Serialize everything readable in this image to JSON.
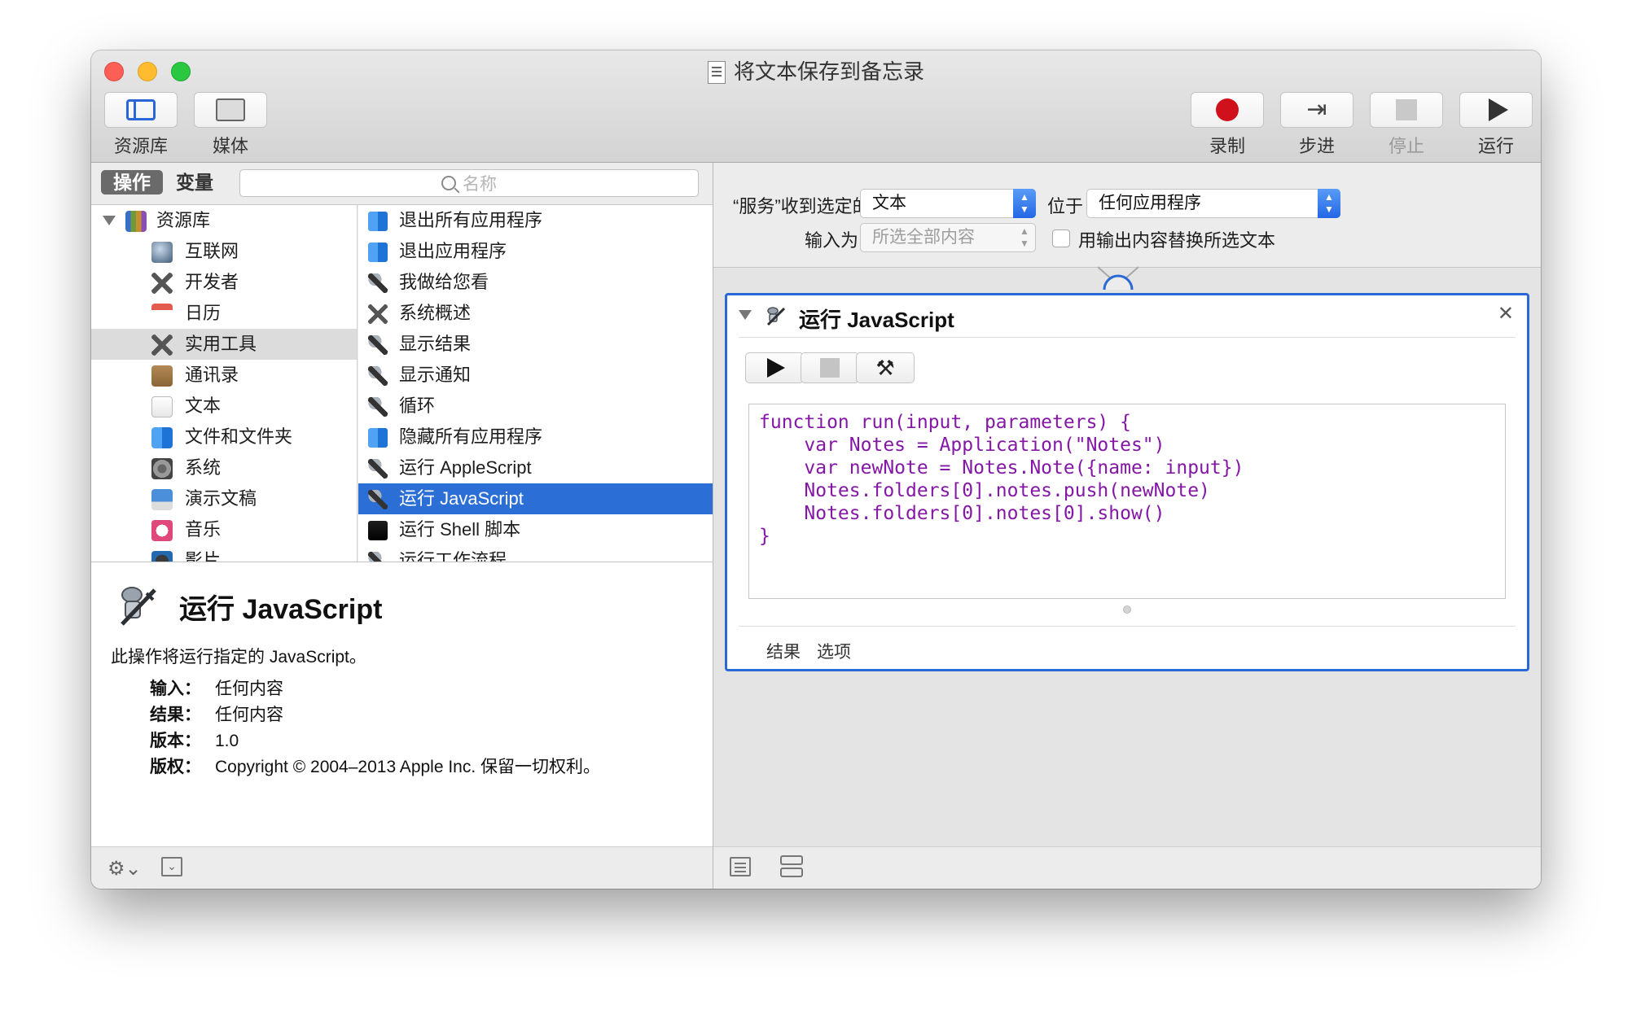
{
  "window": {
    "title": "将文本保存到备忘录"
  },
  "toolbar": {
    "left": [
      {
        "label": "资源库",
        "icon": "library-icon"
      },
      {
        "label": "媒体",
        "icon": "media-icon"
      }
    ],
    "right": [
      {
        "label": "录制",
        "icon": "record-icon",
        "enabled": true
      },
      {
        "label": "步进",
        "icon": "step-icon",
        "enabled": true
      },
      {
        "label": "停止",
        "icon": "stop-icon",
        "enabled": false
      },
      {
        "label": "运行",
        "icon": "run-icon",
        "enabled": true
      }
    ]
  },
  "library": {
    "segments": {
      "actions": "操作",
      "variables": "变量"
    },
    "search_placeholder": "名称",
    "categories": [
      {
        "label": "资源库",
        "icon": "library-books-icon",
        "root": true,
        "selected": false
      },
      {
        "label": "互联网",
        "icon": "globe-icon",
        "selected": false
      },
      {
        "label": "开发者",
        "icon": "tools-icon",
        "selected": false
      },
      {
        "label": "日历",
        "icon": "calendar-icon",
        "selected": false
      },
      {
        "label": "实用工具",
        "icon": "tools-icon",
        "selected": true
      },
      {
        "label": "通讯录",
        "icon": "contacts-icon",
        "selected": false
      },
      {
        "label": "文本",
        "icon": "text-doc-icon",
        "selected": false
      },
      {
        "label": "文件和文件夹",
        "icon": "finder-icon",
        "selected": false
      },
      {
        "label": "系统",
        "icon": "system-icon",
        "selected": false
      },
      {
        "label": "演示文稿",
        "icon": "presentation-icon",
        "selected": false
      },
      {
        "label": "音乐",
        "icon": "music-icon",
        "selected": false
      },
      {
        "label": "影片",
        "icon": "movie-icon",
        "selected": false
      }
    ],
    "actions": [
      {
        "label": "退出所有应用程序",
        "icon": "finder-icon",
        "selected": false
      },
      {
        "label": "退出应用程序",
        "icon": "finder-icon",
        "selected": false
      },
      {
        "label": "我做给您看",
        "icon": "automator-icon",
        "selected": false
      },
      {
        "label": "系统概述",
        "icon": "tools-icon",
        "selected": false
      },
      {
        "label": "显示结果",
        "icon": "automator-icon",
        "selected": false
      },
      {
        "label": "显示通知",
        "icon": "automator-icon",
        "selected": false
      },
      {
        "label": "循环",
        "icon": "automator-icon",
        "selected": false
      },
      {
        "label": "隐藏所有应用程序",
        "icon": "finder-icon",
        "selected": false
      },
      {
        "label": "运行 AppleScript",
        "icon": "automator-icon",
        "selected": false
      },
      {
        "label": "运行 JavaScript",
        "icon": "automator-icon",
        "selected": true
      },
      {
        "label": "运行 Shell 脚本",
        "icon": "terminal-icon",
        "selected": false
      },
      {
        "label": "运行工作流程",
        "icon": "automator-icon",
        "selected": false
      }
    ]
  },
  "description": {
    "title": "运行 JavaScript",
    "text": "此操作将运行指定的 JavaScript。",
    "meta": [
      {
        "key": "输入：",
        "value": "任何内容"
      },
      {
        "key": "结果：",
        "value": "任何内容"
      },
      {
        "key": "版本：",
        "value": "1.0"
      },
      {
        "key": "版权：",
        "value": "Copyright © 2004–2013 Apple Inc. 保留一切权利。"
      }
    ]
  },
  "workflow": {
    "service_receives_label": "“服务”收到选定的",
    "service_receives_value": "文本",
    "in_label": "位于",
    "in_value": "任何应用程序",
    "input_is_label": "输入为",
    "input_is_value": "所选全部内容",
    "replace_label": "用输出内容替换所选文本",
    "replace_checked": false
  },
  "action_card": {
    "title": "运行 JavaScript",
    "code": "function run(input, parameters) {\n    var Notes = Application(\"Notes\")\n    var newNote = Notes.Note({name: input})\n    Notes.folders[0].notes.push(newNote)\n    Notes.folders[0].notes[0].show()\n}",
    "tabs": [
      "结果",
      "选项"
    ]
  },
  "colors": {
    "accent": "#2a68d6",
    "selection": "#2b6fd6",
    "code": "#8417a6",
    "record": "#d0101a"
  }
}
